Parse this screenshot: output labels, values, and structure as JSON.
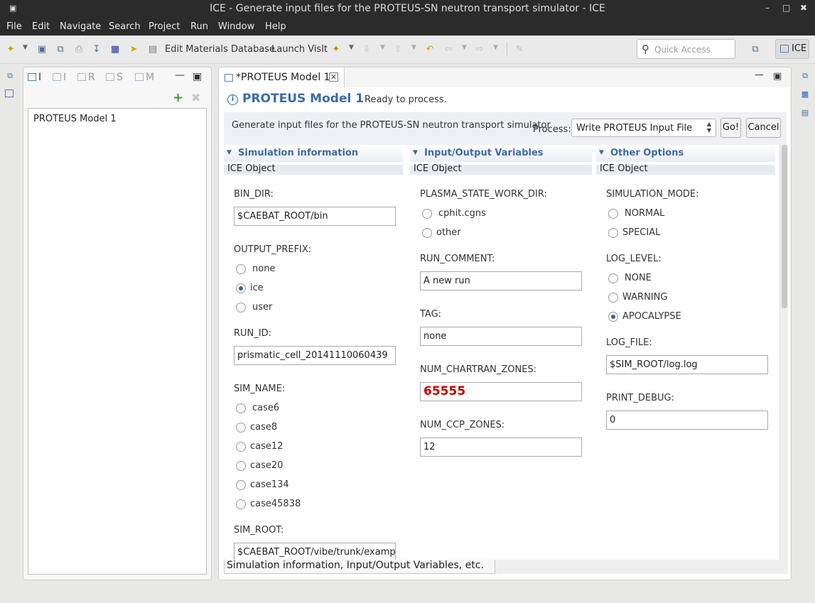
{
  "window": {
    "title": "ICE - Generate input files for the PROTEUS-SN neutron transport simulator - ICE",
    "menu_icon": "window-menu-icon",
    "controls": {
      "minimize": "–",
      "maximize": "□",
      "close": "✖"
    }
  },
  "menubar": [
    "File",
    "Edit",
    "Navigate",
    "Search",
    "Project",
    "Run",
    "Window",
    "Help"
  ],
  "toolbar": {
    "edit_materials": "Edit Materials Database",
    "launch_visit": "Launch VisIt",
    "quick_access_placeholder": "Quick Access",
    "perspective": "ICE"
  },
  "left_view": {
    "tabs": [
      "I",
      "I",
      "R",
      "S",
      "M"
    ],
    "items": [
      "PROTEUS Model 1"
    ]
  },
  "editor": {
    "tab_label": "*PROTEUS Model 1",
    "form_name": "PROTEUS Model 1",
    "status": "Ready to process.",
    "description": "Generate input files for the PROTEUS-SN neutron transport simulator",
    "process_label": "Process:",
    "process_value": "Write PROTEUS Input File",
    "go_label": "Go!",
    "cancel_label": "Cancel",
    "bottom_tab": "Simulation information, Input/Output Variables, etc."
  },
  "sections": {
    "sim": {
      "title": "Simulation information",
      "subtitle": "ICE Object",
      "bin_dir_label": "BIN_DIR:",
      "bin_dir_value": "$CAEBAT_ROOT/bin",
      "output_prefix_label": "OUTPUT_PREFIX:",
      "output_prefix_options": [
        "none",
        "ice",
        "user"
      ],
      "output_prefix_selected": "ice",
      "run_id_label": "RUN_ID:",
      "run_id_value": "prismatic_cell_20141110060439",
      "sim_name_label": "SIM_NAME:",
      "sim_name_options": [
        "case6",
        "case8",
        "case12",
        "case20",
        "case134",
        "case45838"
      ],
      "sim_root_label": "SIM_ROOT:",
      "sim_root_value": "$CAEBAT_ROOT/vibe/trunk/examples"
    },
    "io": {
      "title": "Input/Output Variables",
      "subtitle": "ICE Object",
      "plasma_label": "PLASMA_STATE_WORK_DIR:",
      "plasma_options": [
        "cphit.cgns",
        "other"
      ],
      "run_comment_label": "RUN_COMMENT:",
      "run_comment_value": "A new run",
      "tag_label": "TAG:",
      "tag_value": "none",
      "chartran_label": "NUM_CHARTRAN_ZONES:",
      "chartran_value": "65555",
      "ccp_label": "NUM_CCP_ZONES:",
      "ccp_value": "12"
    },
    "other": {
      "title": "Other Options",
      "subtitle": "ICE Object",
      "sim_mode_label": "SIMULATION_MODE:",
      "sim_mode_options": [
        "NORMAL",
        "SPECIAL"
      ],
      "log_level_label": "LOG_LEVEL:",
      "log_level_options": [
        "NONE",
        "WARNING",
        "APOCALYPSE"
      ],
      "log_level_selected": "APOCALYPSE",
      "log_file_label": "LOG_FILE:",
      "log_file_value": "$SIM_ROOT/log.log",
      "print_debug_label": "PRINT_DEBUG:",
      "print_debug_value": "0"
    }
  },
  "colors": {
    "accent": "#3b6ba6",
    "error_value": "#c00000",
    "titlebar": "#2b2b2b"
  }
}
